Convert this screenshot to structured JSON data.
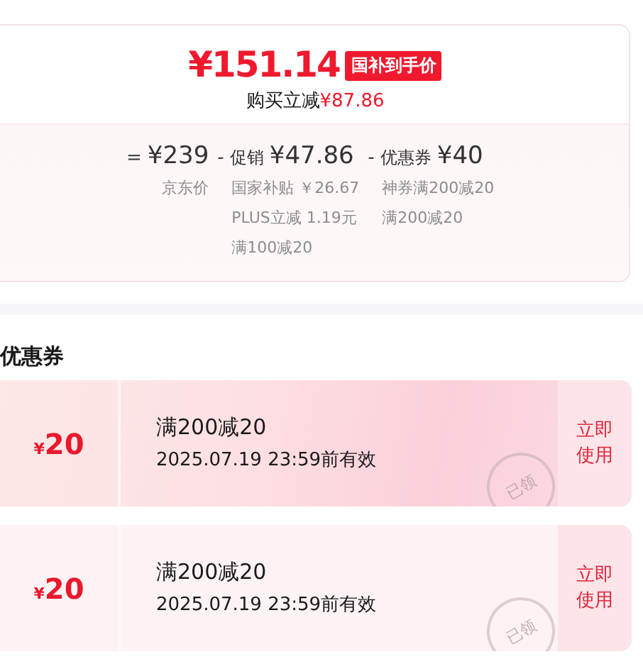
{
  "price": {
    "amount": "¥151.14",
    "tag": "国补到手价",
    "saving_label": "购买立减",
    "saving_amount": "¥87.86"
  },
  "formula": [
    {
      "op": "=",
      "value": "¥239",
      "notes": [
        "京东价"
      ]
    },
    {
      "op": "-",
      "label": "促销",
      "value": "¥47.86",
      "notes": [
        "国家补贴 ￥26.67",
        "PLUS立减 1.19元",
        "满100减20"
      ]
    },
    {
      "op": "-",
      "label": "优惠券",
      "value": "¥40",
      "notes": [
        "神券满200减20",
        "满200减20"
      ]
    }
  ],
  "coupons_title": "优惠券",
  "coupons": [
    {
      "currency": "¥",
      "amount": "20",
      "condition": "满200减20",
      "validity": "2025.07.19 23:59前有效",
      "stamp": "已领",
      "action": "立即使用",
      "kind": "gradient"
    },
    {
      "currency": "¥",
      "amount": "20",
      "condition": "满200减20",
      "validity": "2025.07.19 23:59前有效",
      "stamp": "已领",
      "action": "立即使用",
      "kind": "plain"
    }
  ]
}
